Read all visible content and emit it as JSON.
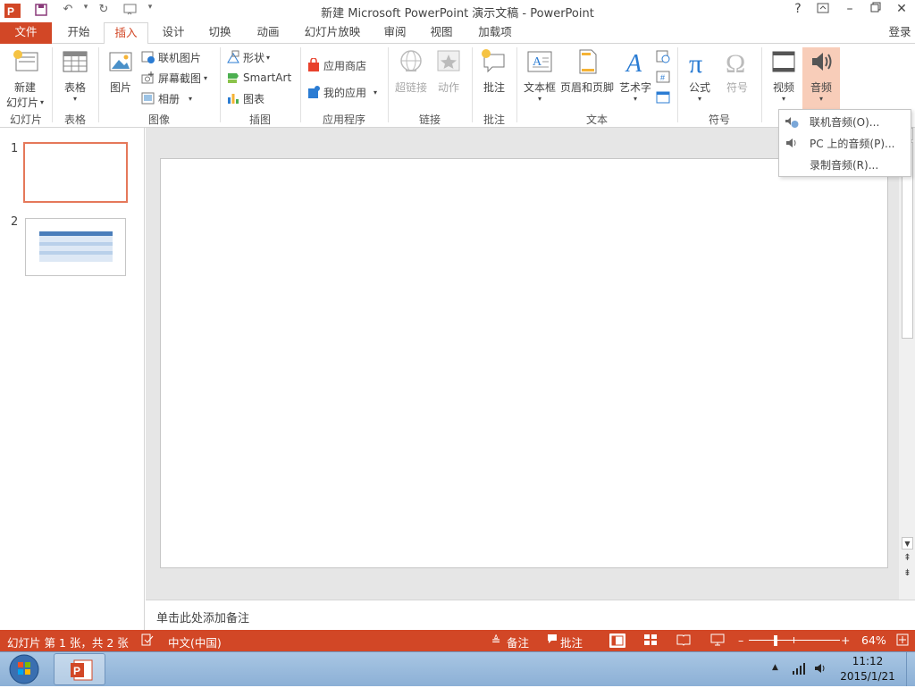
{
  "window": {
    "title": "新建 Microsoft PowerPoint 演示文稿 - PowerPoint",
    "help": "?",
    "signin": "登录"
  },
  "tabs": [
    {
      "label": "文件"
    },
    {
      "label": "开始"
    },
    {
      "label": "插入"
    },
    {
      "label": "设计"
    },
    {
      "label": "切换"
    },
    {
      "label": "动画"
    },
    {
      "label": "幻灯片放映"
    },
    {
      "label": "审阅"
    },
    {
      "label": "视图"
    },
    {
      "label": "加载项"
    }
  ],
  "ribbon": {
    "slides": {
      "new_slide_line1": "新建",
      "new_slide_line2": "幻灯片",
      "label": "幻灯片"
    },
    "tables": {
      "table": "表格",
      "label": "表格"
    },
    "images": {
      "picture": "图片",
      "online_picture": "联机图片",
      "screenshot": "屏幕截图",
      "album": "相册",
      "label": "图像"
    },
    "illustrations": {
      "shapes": "形状",
      "smartart": "SmartArt",
      "chart": "图表",
      "label": "插图"
    },
    "apps": {
      "store": "应用商店",
      "my_apps": "我的应用",
      "label": "应用程序"
    },
    "links": {
      "hyperlink": "超链接",
      "action": "动作",
      "label": "链接"
    },
    "comments": {
      "comment": "批注",
      "label": "批注"
    },
    "text": {
      "textbox": "文本框",
      "header_footer": "页眉和页脚",
      "wordart": "艺术字",
      "label": "文本"
    },
    "symbols": {
      "equation": "公式",
      "symbol": "符号",
      "label": "符号"
    },
    "media": {
      "video": "视频",
      "audio": "音频"
    }
  },
  "audio_menu": {
    "items": [
      {
        "label": "联机音频(O)..."
      },
      {
        "label": "PC 上的音频(P)..."
      },
      {
        "label": "录制音频(R)..."
      }
    ]
  },
  "thumbnails": [
    {
      "number": "1"
    },
    {
      "number": "2"
    }
  ],
  "notes": {
    "placeholder": "单击此处添加备注"
  },
  "status": {
    "slide_info": "幻灯片 第 1 张，共 2 张",
    "language": "中文(中国)",
    "notes": "备注",
    "comments": "批注",
    "zoom": "64%",
    "zoom_level": 0.64
  },
  "taskbar": {
    "time": "11:12",
    "date": "2015/1/21"
  },
  "colors": {
    "accent": "#d24726"
  }
}
